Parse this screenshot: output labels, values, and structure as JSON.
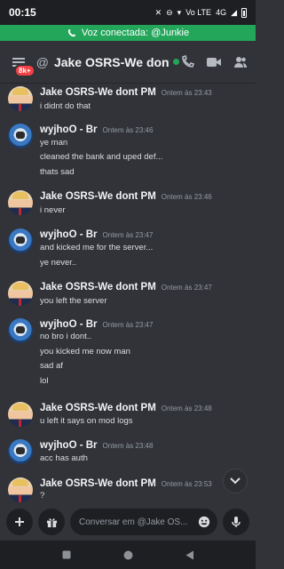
{
  "status": {
    "time": "00:15",
    "net": "Vo LTE",
    "signal": "4G"
  },
  "voice": {
    "label": "Voz conectada: @Junkie"
  },
  "header": {
    "badge": "8k+",
    "at": "@",
    "title": "Jake OSRS-We dont..."
  },
  "messages": [
    {
      "author": "Jake OSRS-We dont PM",
      "avatar": "jake",
      "timestamp": "Ontem às 23:43",
      "lines": [
        "i didnt do that"
      ]
    },
    {
      "author": "wyjhoO - Br",
      "avatar": "wy",
      "timestamp": "Ontem às 23:46",
      "lines": [
        "ye man",
        "cleaned the bank and uped def...",
        "thats sad"
      ]
    },
    {
      "author": "Jake OSRS-We dont PM",
      "avatar": "jake",
      "timestamp": "Ontem às 23:46",
      "lines": [
        "i never"
      ]
    },
    {
      "author": "wyjhoO - Br",
      "avatar": "wy",
      "timestamp": "Ontem às 23:47",
      "lines": [
        "and kicked me for the server...",
        "ye never.."
      ]
    },
    {
      "author": "Jake OSRS-We dont PM",
      "avatar": "jake",
      "timestamp": "Ontem às 23:47",
      "lines": [
        "you left the server"
      ]
    },
    {
      "author": "wyjhoO - Br",
      "avatar": "wy",
      "timestamp": "Ontem às 23:47",
      "lines": [
        "no bro i dont..",
        "you kicked me now man",
        "sad af",
        "lol"
      ]
    },
    {
      "author": "Jake OSRS-We dont PM",
      "avatar": "jake",
      "timestamp": "Ontem às 23:48",
      "lines": [
        "u left it says on mod logs"
      ]
    },
    {
      "author": "wyjhoO - Br",
      "avatar": "wy",
      "timestamp": "Ontem às 23:48",
      "lines": [
        "acc has auth"
      ]
    },
    {
      "author": "Jake OSRS-We dont PM",
      "avatar": "jake",
      "timestamp": "Ontem às 23:53",
      "lines": [
        "?"
      ]
    }
  ],
  "composer": {
    "placeholder": "Conversar em @Jake OS..."
  },
  "icons": [
    "phone-icon",
    "video-icon",
    "members-icon",
    "plus-icon",
    "gift-icon",
    "emoji-icon",
    "mic-icon",
    "chevron-down-icon"
  ],
  "colors": {
    "online": "#23a55a",
    "badge": "#f23f43",
    "background": "#313338"
  }
}
